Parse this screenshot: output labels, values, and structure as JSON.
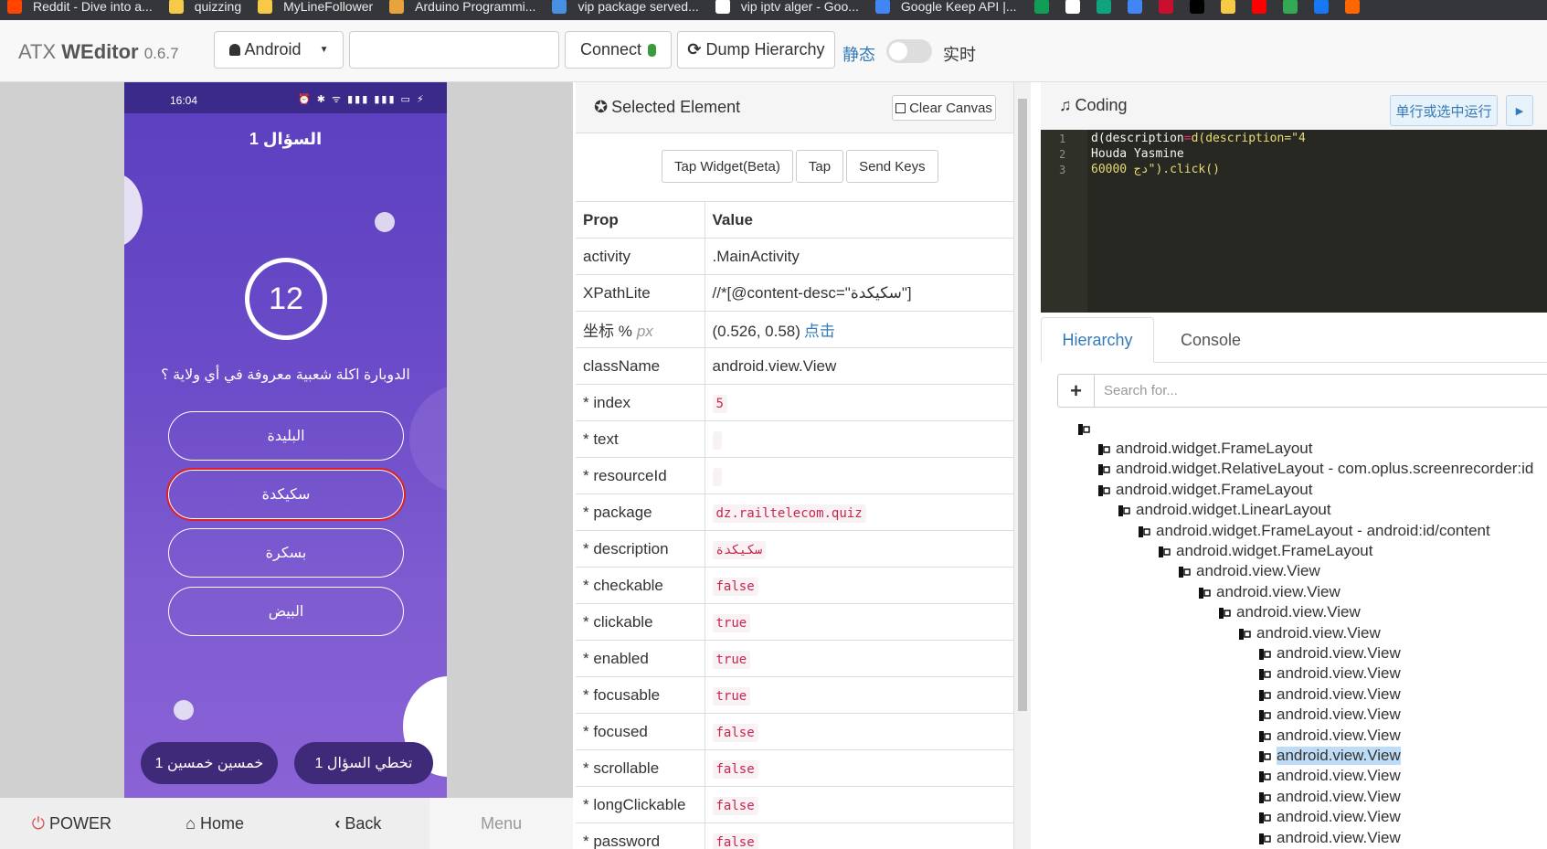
{
  "bookmarks": [
    {
      "label": "Reddit - Dive into a...",
      "color": "#ff4500"
    },
    {
      "label": "quizzing",
      "color": "#f7c948"
    },
    {
      "label": "MyLineFollower",
      "color": "#f7c948"
    },
    {
      "label": "Arduino Programmi...",
      "color": "#e8a33d"
    },
    {
      "label": "vip package served...",
      "color": "#4a90e2"
    },
    {
      "label": "vip iptv alger - Goo...",
      "color": "#ffffff"
    },
    {
      "label": "Google Keep API |...",
      "color": "#4285f4"
    }
  ],
  "bookmark_icons": [
    "#0f9d58",
    "#ffffff",
    "#10a37f",
    "#4285f4",
    "#c8102e",
    "#000000",
    "#f7c948",
    "#ff0000",
    "#34a853",
    "#1877f2",
    "#ff6600"
  ],
  "navbar": {
    "brand_prefix": "ATX ",
    "brand_bold": "WEditor",
    "version": "0.6.7",
    "platform": "Android",
    "connect": "Connect",
    "dump": "Dump Hierarchy",
    "static_label": "静态",
    "realtime_label": "实时"
  },
  "phone": {
    "time": "16:04",
    "title": "السؤال 1",
    "timer": "12",
    "question": "الدوبارة اكلة شعبية معروفة في أي ولاية ؟",
    "answers": [
      "البليدة",
      "سكيكدة",
      "بسكرة",
      "البيض"
    ],
    "skip": "تخطي السؤال 1",
    "fifty": "خمسين خمسين 1"
  },
  "device_keys": {
    "power": "POWER",
    "home": "Home",
    "back": "Back",
    "menu": "Menu"
  },
  "selected": {
    "title": "Selected Element",
    "clear": "Clear Canvas",
    "tap_widget": "Tap Widget(Beta)",
    "tap": "Tap",
    "send_keys": "Send Keys",
    "col_prop": "Prop",
    "col_value": "Value",
    "rows": [
      {
        "k": "activity",
        "v": ".MainActivity",
        "type": "plain"
      },
      {
        "k": "XPathLite",
        "v": "//*[@content-desc=\"سكيكدة\"]",
        "type": "plain"
      },
      {
        "k": "坐标 %",
        "k2": "px",
        "v": "(0.526, 0.58)",
        "link": "点击",
        "type": "coord"
      },
      {
        "k": "className",
        "v": "android.view.View",
        "type": "plain"
      },
      {
        "k": "* index",
        "v": "5",
        "type": "code"
      },
      {
        "k": "* text",
        "v": "",
        "type": "code"
      },
      {
        "k": "* resourceId",
        "v": "",
        "type": "code"
      },
      {
        "k": "* package",
        "v": "dz.railtelecom.quiz",
        "type": "code"
      },
      {
        "k": "* description",
        "v": "سكيكدة",
        "type": "code"
      },
      {
        "k": "* checkable",
        "v": "false",
        "type": "code"
      },
      {
        "k": "* clickable",
        "v": "true",
        "type": "code"
      },
      {
        "k": "* enabled",
        "v": "true",
        "type": "code"
      },
      {
        "k": "* focusable",
        "v": "true",
        "type": "code"
      },
      {
        "k": "* focused",
        "v": "false",
        "type": "code"
      },
      {
        "k": "* scrollable",
        "v": "false",
        "type": "code"
      },
      {
        "k": "* longClickable",
        "v": "false",
        "type": "code"
      },
      {
        "k": "* password",
        "v": "false",
        "type": "code"
      }
    ]
  },
  "coding": {
    "title": "Coding",
    "run": "单行或选中运行",
    "lines": [
      "d(description=\"4",
      "Houda Yasmine",
      "60000 دج\").click()"
    ]
  },
  "tabs": {
    "hierarchy": "Hierarchy",
    "console": "Console"
  },
  "search_placeholder": "Search for...",
  "tree": [
    {
      "label": "",
      "depth": 0
    },
    {
      "label": "android.widget.FrameLayout",
      "depth": 1
    },
    {
      "label": "android.widget.RelativeLayout - com.oplus.screenrecorder:id",
      "depth": 1
    },
    {
      "label": "android.widget.FrameLayout",
      "depth": 1
    },
    {
      "label": "android.widget.LinearLayout",
      "depth": 2
    },
    {
      "label": "android.widget.FrameLayout - android:id/content",
      "depth": 3
    },
    {
      "label": "android.widget.FrameLayout",
      "depth": 4
    },
    {
      "label": "android.view.View",
      "depth": 5
    },
    {
      "label": "android.view.View",
      "depth": 6
    },
    {
      "label": "android.view.View",
      "depth": 7
    },
    {
      "label": "android.view.View",
      "depth": 8
    },
    {
      "label": "android.view.View",
      "depth": 9
    },
    {
      "label": "android.view.View",
      "depth": 9
    },
    {
      "label": "android.view.View",
      "depth": 9
    },
    {
      "label": "android.view.View",
      "depth": 9
    },
    {
      "label": "android.view.View",
      "depth": 9
    },
    {
      "label": "android.view.View",
      "depth": 9,
      "selected": true
    },
    {
      "label": "android.view.View",
      "depth": 9
    },
    {
      "label": "android.view.View",
      "depth": 9
    },
    {
      "label": "android.view.View",
      "depth": 9
    },
    {
      "label": "android.view.View",
      "depth": 9
    }
  ]
}
